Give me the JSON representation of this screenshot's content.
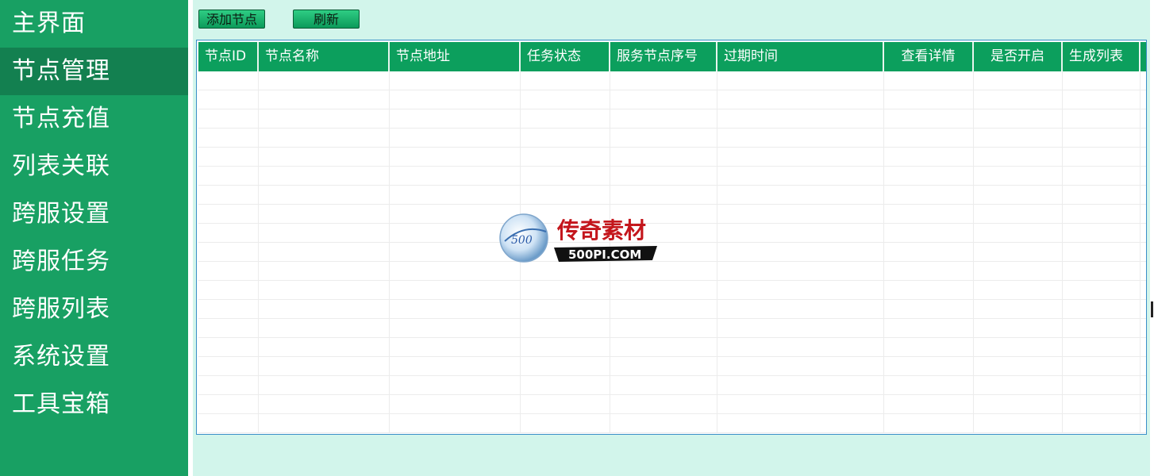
{
  "sidebar": {
    "items": [
      {
        "label": "主界面"
      },
      {
        "label": "节点管理"
      },
      {
        "label": "节点充值"
      },
      {
        "label": "列表关联"
      },
      {
        "label": "跨服设置"
      },
      {
        "label": "跨服任务"
      },
      {
        "label": "跨服列表"
      },
      {
        "label": "系统设置"
      },
      {
        "label": "工具宝箱"
      }
    ],
    "active_index": 1
  },
  "toolbar": {
    "add_node_label": "添加节点",
    "refresh_label": "刷新"
  },
  "table": {
    "columns": [
      {
        "label": "节点ID"
      },
      {
        "label": "节点名称"
      },
      {
        "label": "节点地址"
      },
      {
        "label": "任务状态"
      },
      {
        "label": "服务节点序号"
      },
      {
        "label": "过期时间"
      },
      {
        "label": "查看详情"
      },
      {
        "label": "是否开启"
      },
      {
        "label": "生成列表"
      }
    ],
    "rows": []
  },
  "watermark": {
    "logo_text": "传奇素材",
    "site_text": "500PI.COM",
    "badge_text": "500"
  },
  "colors": {
    "sidebar_bg": "#18a063",
    "sidebar_active": "#138050",
    "header_bg": "#0c9f5d",
    "content_bg": "#d2f5eb"
  }
}
